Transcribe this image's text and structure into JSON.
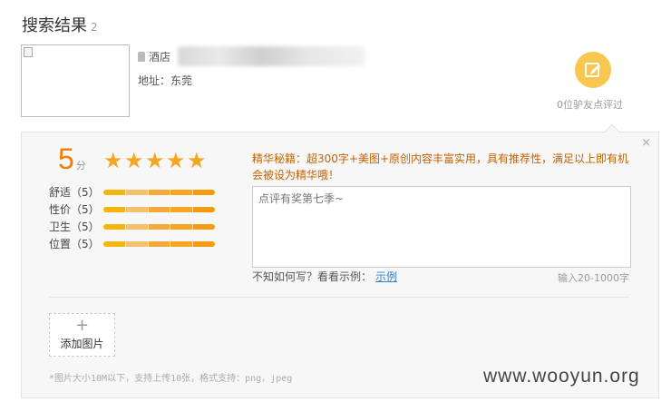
{
  "header": {
    "title": "搜索结果",
    "count": "2"
  },
  "hotel": {
    "type_label": "酒店",
    "address_label": "地址：东莞"
  },
  "review_cta": {
    "count_text": "0位驴友点评过",
    "icon": "edit-icon",
    "color": "#f9c74f"
  },
  "panel": {
    "close": "×",
    "score": {
      "value": "5",
      "unit": "分"
    },
    "stars": {
      "count": 5,
      "filled": 5,
      "color": "#f5a623"
    },
    "ratings": [
      {
        "label": "舒适（5）",
        "value": 5
      },
      {
        "label": "性价（5）",
        "value": 5
      },
      {
        "label": "卫生（5）",
        "value": 5
      },
      {
        "label": "位置（5）",
        "value": 5
      }
    ],
    "tips": "精华秘籍：超300字+美图+原创内容丰富实用，具有推荐性，满足以上即有机会被设为精华哦！",
    "textarea_placeholder": "点评有奖第七季~",
    "howto_text": "不知如何写？看看示例：",
    "example_link": "示例",
    "char_limit": "输入20-1000字",
    "add_photo": {
      "plus": "+",
      "label": "添加图片"
    },
    "photo_hint": "*图片大小10M以下，支持上传10张，格式支持：png，jpeg"
  },
  "watermark": "www.wooyun.org"
}
